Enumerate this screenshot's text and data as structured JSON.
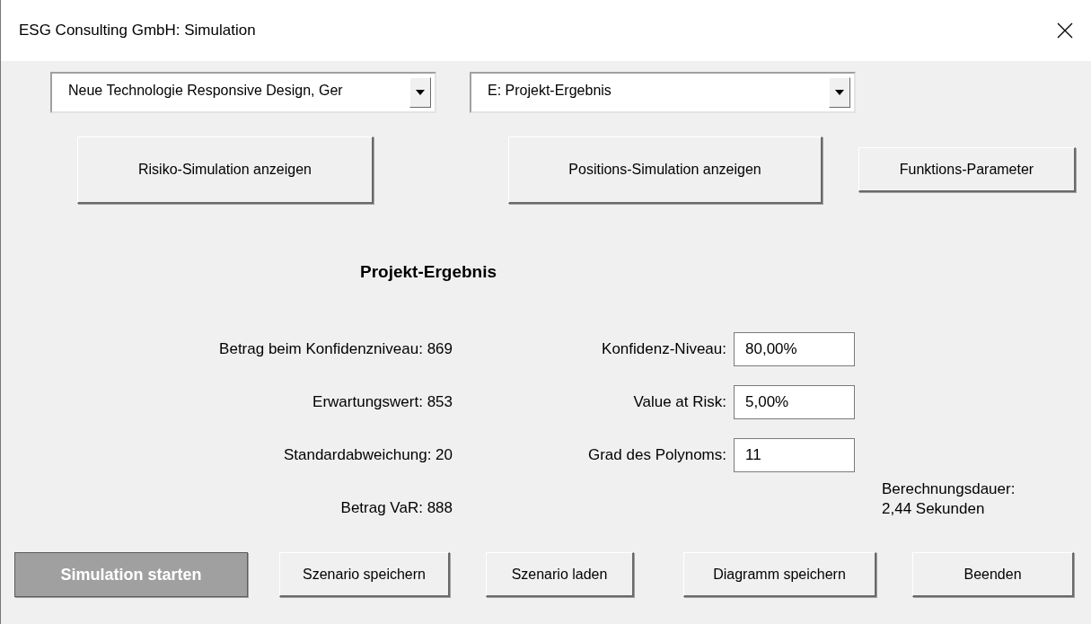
{
  "window": {
    "title": "ESG Consulting GmbH: Simulation"
  },
  "dropdowns": [
    {
      "value": "Neue Technologie Responsive Design, Ger"
    },
    {
      "value": "E: Projekt-Ergebnis"
    }
  ],
  "view_buttons": [
    {
      "label": "Risiko-Simulation anzeigen"
    },
    {
      "label": "Positions-Simulation anzeigen"
    },
    {
      "label": "Funktions-Parameter"
    }
  ],
  "heading": "Projekt-Ergebnis",
  "results": [
    {
      "label": "Betrag beim Konfidenzniveau: 869"
    },
    {
      "label": "Erwartungswert: 853"
    },
    {
      "label": "Standardabweichung: 20"
    },
    {
      "label": "Betrag VaR: 888"
    }
  ],
  "parameters": [
    {
      "label": "Konfidenz-Niveau:",
      "value": "80,00%"
    },
    {
      "label": "Value at Risk:",
      "value": "5,00%"
    },
    {
      "label": "Grad des Polynoms:",
      "value": "11"
    }
  ],
  "duration": [
    "Berechnungsdauer:",
    "2,44 Sekunden"
  ],
  "buttons": [
    {
      "label": "Simulation starten",
      "disabled": true
    },
    {
      "label": "Szenario speichern",
      "disabled": false
    },
    {
      "label": "Szenario laden",
      "disabled": false
    },
    {
      "label": "Diagramm speichern",
      "disabled": false
    },
    {
      "label": "Beenden",
      "disabled": false
    }
  ]
}
